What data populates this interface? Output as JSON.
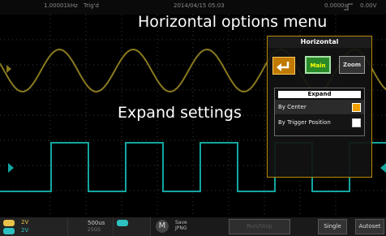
{
  "topbar": {
    "frequency": "1.00001kHz",
    "trigger_status": "Trig'd",
    "date": "2014/04/15  05:03",
    "trigger_position": "0.0000s",
    "trigger_level": "0.00V"
  },
  "annotations": {
    "horizontal_menu": "Horizontal options menu",
    "expand_settings": "Expand settings"
  },
  "horizontal_panel": {
    "title": "Horizontal",
    "back_icon": "return-arrow-icon",
    "main_label": "Main",
    "zoom_label": "Zoom",
    "expand": {
      "heading": "Expand",
      "options": [
        {
          "label": "By Center",
          "checked": true
        },
        {
          "label": "By Trigger Position",
          "checked": false
        }
      ]
    }
  },
  "bottombar": {
    "ch1": {
      "volts": "2V",
      "color": "#e8c24a"
    },
    "ch2": {
      "volts": "2V",
      "color": "#2fc1c1"
    },
    "timebase": "500us",
    "timebase_sub": "25GS",
    "m_label": "M",
    "save_line1": "Save",
    "save_line2": "JPNG",
    "run_stop": "Run/Stop",
    "single": "Single",
    "autoset": "Autoset"
  },
  "colors": {
    "ch1_wave": "#8a7a1e",
    "ch2_wave": "#13a5a0",
    "panel_border": "#b88a00",
    "grid": "#3a3a3a"
  }
}
